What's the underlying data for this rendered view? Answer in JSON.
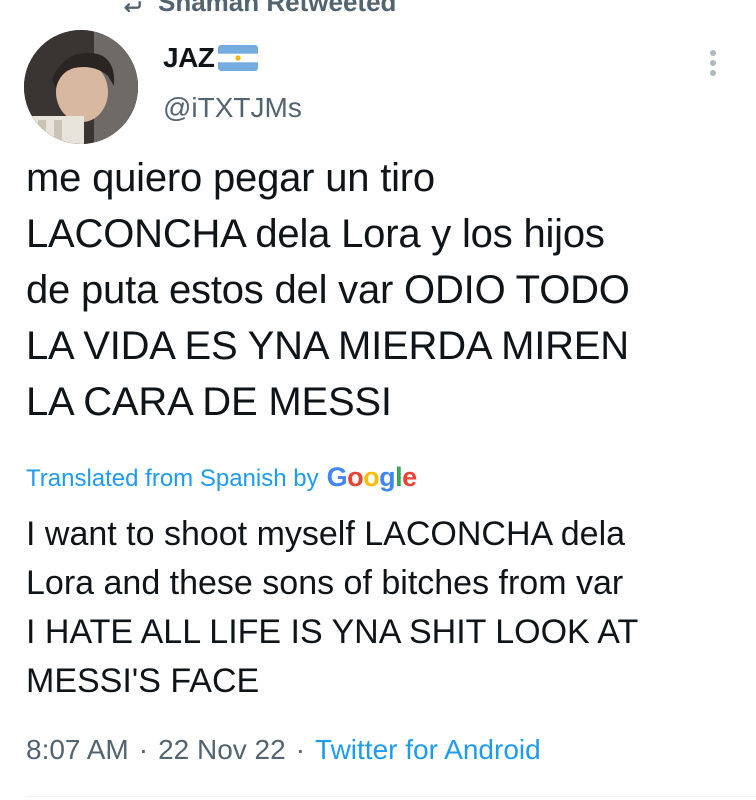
{
  "retweet_bar": {
    "text": "Shaman Retweeted"
  },
  "author": {
    "display_name": "JAZ",
    "handle": "@iTXTJMs"
  },
  "tweet": {
    "text": "me quiero pegar un tiro\nLACONCHA dela Lora y los hijos\nde puta estos del var ODIO TODO\nLA VIDA ES YNA MIERDA MIREN\nLA CARA DE MESSI"
  },
  "translation": {
    "label": "Translated from Spanish by",
    "provider": "Google",
    "text": "I want to shoot myself LACONCHA dela\nLora and these sons of bitches from var\nI HATE ALL LIFE IS YNA SHIT LOOK AT\nMESSI'S FACE"
  },
  "meta": {
    "time": "8:07 AM",
    "date": "22 Nov 22",
    "source": "Twitter for Android",
    "separator": "·"
  },
  "colors": {
    "link": "#1d9bf0",
    "secondary_text": "#536471",
    "primary_text": "#0f1419",
    "google_blue": "#4285F4",
    "google_red": "#EA4335",
    "google_yellow": "#FBBC05",
    "google_green": "#34A853"
  },
  "icons": {
    "retweet": "retweet-icon",
    "more": "more-vertical-icon",
    "flag": "argentina-flag-icon"
  }
}
